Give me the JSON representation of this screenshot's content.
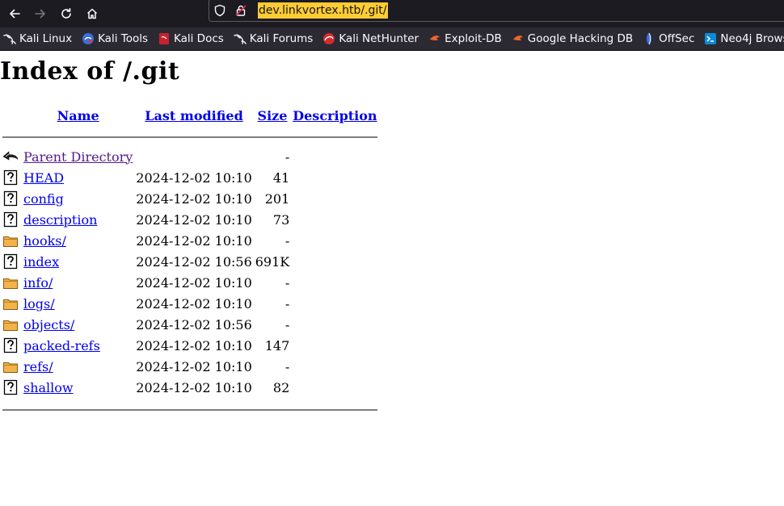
{
  "browser": {
    "url": "dev.linkvortex.htb/.git/",
    "bookmarks": [
      {
        "label": "Kali Linux",
        "icon": "kali-dragon-icon"
      },
      {
        "label": "Kali Tools",
        "icon": "kali-tools-icon"
      },
      {
        "label": "Kali Docs",
        "icon": "kali-docs-icon"
      },
      {
        "label": "Kali Forums",
        "icon": "kali-dragon-icon"
      },
      {
        "label": "Kali NetHunter",
        "icon": "nethunter-icon"
      },
      {
        "label": "Exploit-DB",
        "icon": "exploitdb-icon"
      },
      {
        "label": "Google Hacking DB",
        "icon": "ghdb-icon"
      },
      {
        "label": "OffSec",
        "icon": "offsec-icon"
      },
      {
        "label": "Neo4j Browser",
        "icon": "neo4j-icon"
      }
    ]
  },
  "page": {
    "title": "Index of /.git",
    "columns": {
      "name": "Name",
      "modified": "Last modified",
      "size": "Size",
      "description": "Description"
    },
    "entries": [
      {
        "name": "Parent Directory",
        "modified": "",
        "size": "-",
        "type": "back"
      },
      {
        "name": "HEAD",
        "modified": "2024-12-02 10:10",
        "size": "41",
        "type": "file"
      },
      {
        "name": "config",
        "modified": "2024-12-02 10:10",
        "size": "201",
        "type": "file"
      },
      {
        "name": "description",
        "modified": "2024-12-02 10:10",
        "size": "73",
        "type": "file"
      },
      {
        "name": "hooks/",
        "modified": "2024-12-02 10:10",
        "size": "-",
        "type": "folder"
      },
      {
        "name": "index",
        "modified": "2024-12-02 10:56",
        "size": "691K",
        "type": "file"
      },
      {
        "name": "info/",
        "modified": "2024-12-02 10:10",
        "size": "-",
        "type": "folder"
      },
      {
        "name": "logs/",
        "modified": "2024-12-02 10:10",
        "size": "-",
        "type": "folder"
      },
      {
        "name": "objects/",
        "modified": "2024-12-02 10:56",
        "size": "-",
        "type": "folder"
      },
      {
        "name": "packed-refs",
        "modified": "2024-12-02 10:10",
        "size": "147",
        "type": "file"
      },
      {
        "name": "refs/",
        "modified": "2024-12-02 10:10",
        "size": "-",
        "type": "folder"
      },
      {
        "name": "shallow",
        "modified": "2024-12-02 10:10",
        "size": "82",
        "type": "file"
      }
    ]
  }
}
